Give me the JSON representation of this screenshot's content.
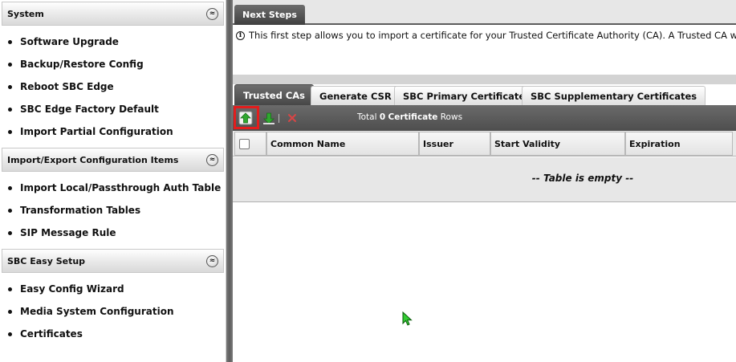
{
  "sidebar": {
    "sections": [
      {
        "title": "System",
        "items": [
          "Software Upgrade",
          "Backup/Restore Config",
          "Reboot SBC Edge",
          "SBC Edge Factory Default",
          "Import Partial Configuration"
        ]
      },
      {
        "title": "Import/Export Configuration Items",
        "items": [
          "Import Local/Passthrough Auth Table",
          "Transformation Tables",
          "SIP Message Rule"
        ]
      },
      {
        "title": "SBC Easy Setup",
        "items": [
          "Easy Config Wizard",
          "Media System Configuration",
          "Certificates"
        ]
      }
    ],
    "collapse_glyph": "≈"
  },
  "next_steps": {
    "tab_label": "Next Steps",
    "info_icon": "info-icon",
    "text": "This first step allows you to import a certificate for your Trusted Certificate Authority (CA). A Trusted CA will"
  },
  "tabs": [
    {
      "label": "Trusted CAs",
      "active": true
    },
    {
      "label": "Generate CSR",
      "active": false
    },
    {
      "label": "SBC Primary Certificate",
      "active": false
    },
    {
      "label": "SBC Supplementary Certificates",
      "active": false
    }
  ],
  "toolbar": {
    "import_icon": "import-up-arrow-icon",
    "export_icon": "export-down-arrow-icon",
    "delete_icon": "delete-x-icon",
    "total_prefix": "Total",
    "total_count": "0",
    "total_suffix_bold": "Certificate",
    "total_suffix": "Rows"
  },
  "grid": {
    "columns": [
      "Common Name",
      "Issuer",
      "Start Validity",
      "Expiration"
    ],
    "empty_message": "-- Table is empty --"
  },
  "colors": {
    "highlight": "#e31d1d",
    "arrow_green": "#2fa82f",
    "delete_red": "#d94545"
  }
}
